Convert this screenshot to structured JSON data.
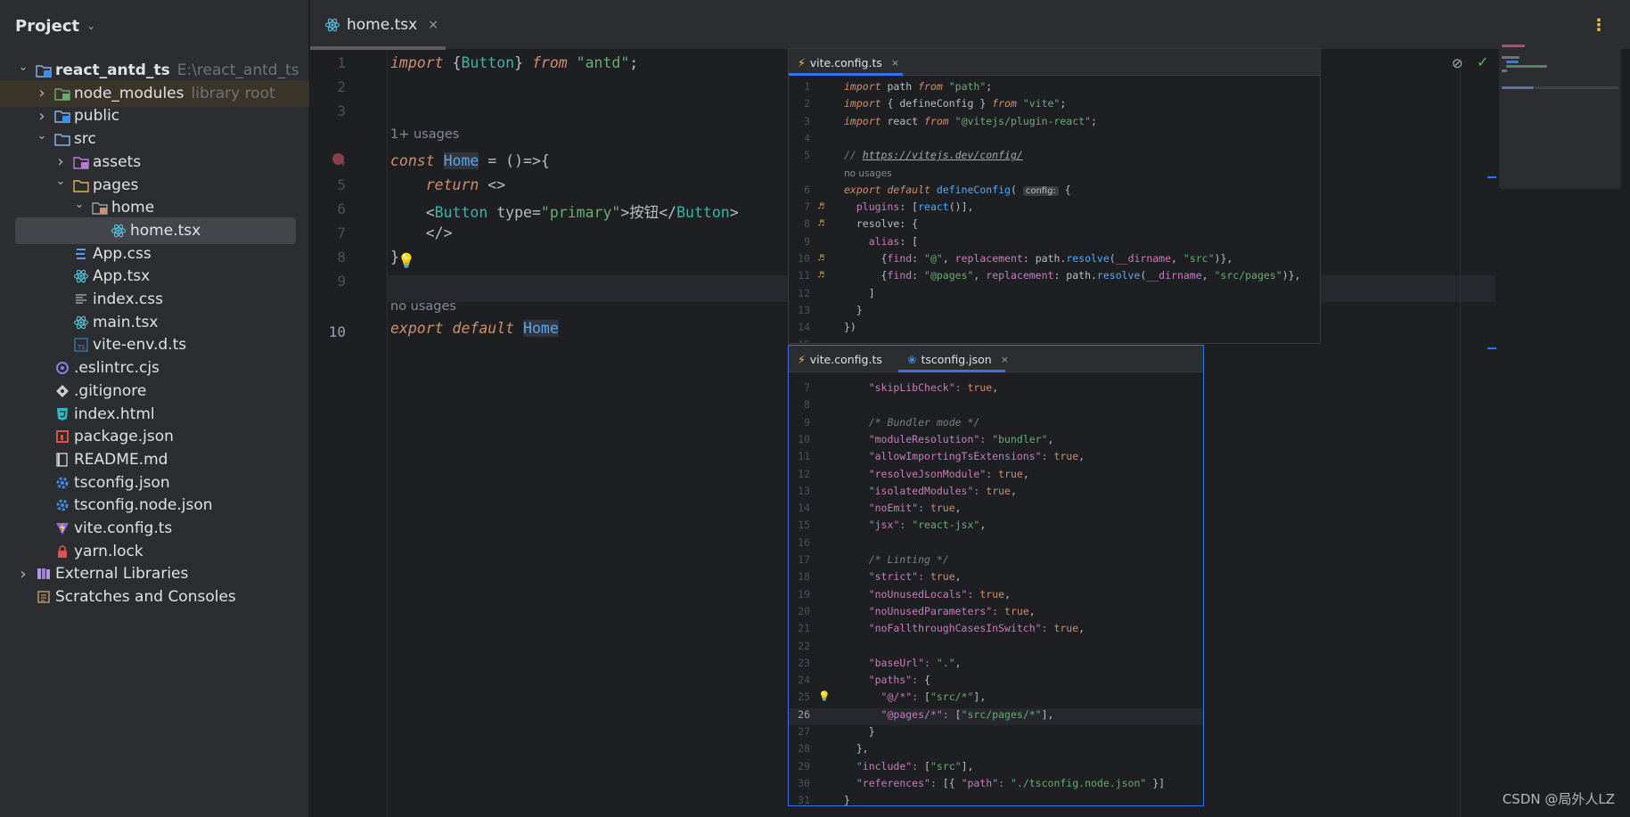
{
  "sidebar": {
    "title": "Project",
    "tree": [
      {
        "label": "react_antd_ts",
        "hint": "E:\\react_antd_ts",
        "arrow": "down",
        "icon": "folder-module-icon",
        "depth": 0,
        "bold": true
      },
      {
        "label": "node_modules",
        "hint": "library root",
        "arrow": "right",
        "icon": "folder-node-icon",
        "depth": 1,
        "highlight": true
      },
      {
        "label": "public",
        "arrow": "right",
        "icon": "folder-web-icon",
        "depth": 1
      },
      {
        "label": "src",
        "arrow": "down",
        "icon": "folder-source-icon",
        "depth": 1
      },
      {
        "label": "assets",
        "arrow": "right",
        "icon": "folder-resources-icon",
        "depth": 2
      },
      {
        "label": "pages",
        "arrow": "down",
        "icon": "folder-icon",
        "depth": 2
      },
      {
        "label": "home",
        "arrow": "down",
        "icon": "folder-gray-icon",
        "depth": 3
      },
      {
        "label": "home.tsx",
        "arrow": "",
        "icon": "react-icon",
        "depth": 4,
        "selected": true
      },
      {
        "label": "App.css",
        "arrow": "",
        "icon": "css-icon",
        "depth": 2
      },
      {
        "label": "App.tsx",
        "arrow": "",
        "icon": "react-icon",
        "depth": 2
      },
      {
        "label": "index.css",
        "arrow": "",
        "icon": "text-file-icon",
        "depth": 2
      },
      {
        "label": "main.tsx",
        "arrow": "",
        "icon": "react-icon",
        "depth": 2
      },
      {
        "label": "vite-env.d.ts",
        "arrow": "",
        "icon": "ts-icon",
        "depth": 2
      },
      {
        "label": ".eslintrc.cjs",
        "arrow": "",
        "icon": "eslint-icon",
        "depth": 1
      },
      {
        "label": ".gitignore",
        "arrow": "",
        "icon": "git-icon",
        "depth": 1
      },
      {
        "label": "index.html",
        "arrow": "",
        "icon": "html-icon",
        "depth": 1
      },
      {
        "label": "package.json",
        "arrow": "",
        "icon": "npm-icon",
        "depth": 1
      },
      {
        "label": "README.md",
        "arrow": "",
        "icon": "markdown-icon",
        "depth": 1
      },
      {
        "label": "tsconfig.json",
        "arrow": "",
        "icon": "tsconfig-icon",
        "depth": 1
      },
      {
        "label": "tsconfig.node.json",
        "arrow": "",
        "icon": "tsconfig-icon",
        "depth": 1
      },
      {
        "label": "vite.config.ts",
        "arrow": "",
        "icon": "vite-icon",
        "depth": 1
      },
      {
        "label": "yarn.lock",
        "arrow": "",
        "icon": "lock-icon",
        "depth": 1
      },
      {
        "label": "External Libraries",
        "arrow": "right",
        "icon": "library-icon",
        "depth": 0
      },
      {
        "label": "Scratches and Consoles",
        "arrow": "",
        "icon": "scratches-icon",
        "depth": 0
      }
    ]
  },
  "editor": {
    "tab": {
      "label": "home.tsx",
      "close": "×"
    },
    "usage_hint_1": "1+ usages",
    "usage_hint_2": "no usages",
    "line_numbers": [
      "1",
      "2",
      "3",
      "4",
      "5",
      "6",
      "7",
      "8",
      "9",
      "10"
    ],
    "lines": [
      "import {Button} from \"antd\";",
      "",
      "",
      "const Home = ()=>{",
      "    return <>",
      "    <Button type=\"primary\">按钮</Button>",
      "    </>",
      "}",
      "",
      "export default Home"
    ],
    "more_icon": "⋮"
  },
  "popup_vite": {
    "tab_label": "vite.config.ts",
    "close": "×",
    "lines": [
      {
        "n": "1",
        "text": "import path from \"path\";"
      },
      {
        "n": "2",
        "text": "import { defineConfig } from \"vite\";"
      },
      {
        "n": "3",
        "text": "import react from \"@vitejs/plugin-react\";"
      },
      {
        "n": "4",
        "text": ""
      },
      {
        "n": "5",
        "text": "// https://vitejs.dev/config/"
      },
      {
        "n": "",
        "text": "no usages"
      },
      {
        "n": "6",
        "text": "export default defineConfig( config: {"
      },
      {
        "n": "7",
        "text": "  plugins: [react()],"
      },
      {
        "n": "8",
        "text": "  resolve: {"
      },
      {
        "n": "9",
        "text": "    alias: ["
      },
      {
        "n": "10",
        "text": "      {find: \"@\", replacement: path.resolve(__dirname, \"src\")},"
      },
      {
        "n": "11",
        "text": "      {find: \"@pages\", replacement: path.resolve(__dirname, \"src/pages\")},"
      },
      {
        "n": "12",
        "text": "    ]"
      },
      {
        "n": "13",
        "text": "  }"
      },
      {
        "n": "14",
        "text": "})"
      },
      {
        "n": "15",
        "text": ""
      }
    ]
  },
  "popup_tsconfig": {
    "tab_inactive": "vite.config.ts",
    "tab_active": "tsconfig.json",
    "close": "×",
    "lines": [
      {
        "n": "7",
        "text": "    \"skipLibCheck\": true,"
      },
      {
        "n": "8",
        "text": ""
      },
      {
        "n": "9",
        "text": "    /* Bundler mode */"
      },
      {
        "n": "10",
        "text": "    \"moduleResolution\": \"bundler\","
      },
      {
        "n": "11",
        "text": "    \"allowImportingTsExtensions\": true,"
      },
      {
        "n": "12",
        "text": "    \"resolveJsonModule\": true,"
      },
      {
        "n": "13",
        "text": "    \"isolatedModules\": true,"
      },
      {
        "n": "14",
        "text": "    \"noEmit\": true,"
      },
      {
        "n": "15",
        "text": "    \"jsx\": \"react-jsx\","
      },
      {
        "n": "16",
        "text": ""
      },
      {
        "n": "17",
        "text": "    /* Linting */"
      },
      {
        "n": "18",
        "text": "    \"strict\": true,"
      },
      {
        "n": "19",
        "text": "    \"noUnusedLocals\": true,"
      },
      {
        "n": "20",
        "text": "    \"noUnusedParameters\": true,"
      },
      {
        "n": "21",
        "text": "    \"noFallthroughCasesInSwitch\": true,"
      },
      {
        "n": "22",
        "text": ""
      },
      {
        "n": "23",
        "text": "    \"baseUrl\": \".\","
      },
      {
        "n": "24",
        "text": "    \"paths\": {"
      },
      {
        "n": "25",
        "text": "      \"@/*\": [\"src/*\"],"
      },
      {
        "n": "26",
        "text": "      \"@pages/*\": [\"src/pages/*\"],"
      },
      {
        "n": "27",
        "text": "    }"
      },
      {
        "n": "28",
        "text": "  },"
      },
      {
        "n": "29",
        "text": "  \"include\": [\"src\"],"
      },
      {
        "n": "30",
        "text": "  \"references\": [{ \"path\": \"./tsconfig.node.json\" }]"
      },
      {
        "n": "31",
        "text": "}"
      }
    ]
  },
  "watermark": "CSDN @局外人LZ",
  "colors": {
    "accent": "#3574f0",
    "keyword": "#cf8e6d",
    "string": "#6aab73",
    "type": "#2fbaa3",
    "identifier": "#56a8f5",
    "property": "#c77dbb"
  }
}
